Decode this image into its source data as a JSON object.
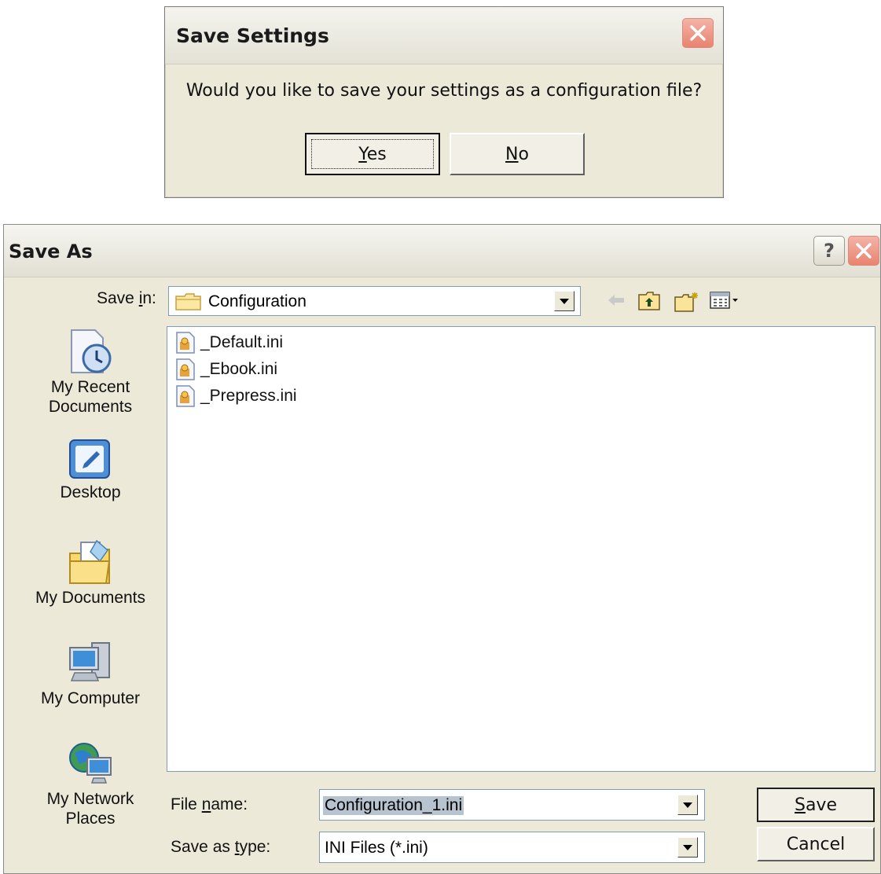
{
  "save_settings_dialog": {
    "title": "Save Settings",
    "message": "Would you like to save your settings as a configuration file?",
    "yes_label": "Yes",
    "no_label": "No"
  },
  "save_as_dialog": {
    "title": "Save As",
    "help_label": "?",
    "save_in_label": "Save in:",
    "save_in_value": "Configuration",
    "places": [
      {
        "label_line1": "My Recent",
        "label_line2": "Documents",
        "icon": "recent-documents-icon"
      },
      {
        "label_line1": "Desktop",
        "label_line2": "",
        "icon": "desktop-icon"
      },
      {
        "label_line1": "My Documents",
        "label_line2": "",
        "icon": "my-documents-icon"
      },
      {
        "label_line1": "My Computer",
        "label_line2": "",
        "icon": "my-computer-icon"
      },
      {
        "label_line1": "My Network",
        "label_line2": "Places",
        "icon": "network-places-icon"
      }
    ],
    "files": [
      "_Default.ini",
      "_Ebook.ini",
      "_Prepress.ini"
    ],
    "file_name_label": "File name:",
    "file_name_value": "Configuration_1.ini",
    "save_as_type_label": "Save as type:",
    "save_as_type_value": "INI Files (*.ini)",
    "save_label": "Save",
    "cancel_label": "Cancel"
  },
  "colors": {
    "dialog_bg": "#ece9d8",
    "close_button": "#e9836f",
    "field_border": "#7f9db9",
    "selection": "#b7c4cf"
  }
}
